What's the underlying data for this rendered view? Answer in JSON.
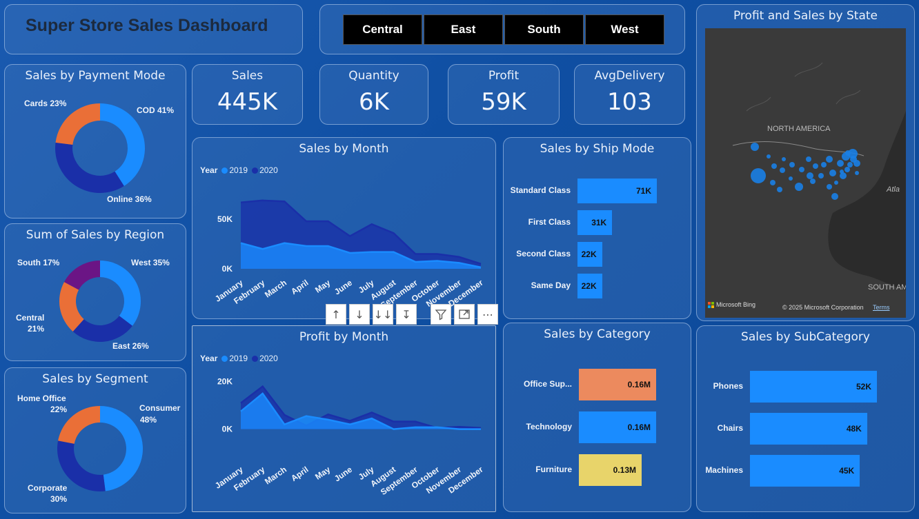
{
  "header": {
    "title": "Super Store Sales Dashboard"
  },
  "regions": [
    "Central",
    "East",
    "South",
    "West"
  ],
  "kpis": [
    {
      "label": "Sales",
      "value": "445K"
    },
    {
      "label": "Quantity",
      "value": "6K"
    },
    {
      "label": "Profit",
      "value": "59K"
    },
    {
      "label": "AvgDelivery",
      "value": "103"
    }
  ],
  "colors": {
    "primary": "#1a8cff",
    "dark": "#1a2fa8",
    "orange": "#ea6f37",
    "purple": "#6b1585",
    "office": "#ec8a5e",
    "furniture": "#e8d46a"
  },
  "payment_mode": {
    "title": "Sales by Payment Mode",
    "labels": [
      "COD 41%",
      "Online 36%",
      "Cards 23%"
    ]
  },
  "region_sales": {
    "title": "Sum of Sales by Region",
    "labels": [
      "West 35%",
      "East 26%",
      "Central",
      "21%",
      "South 17%"
    ]
  },
  "segment": {
    "title": "Sales by Segment",
    "labels": [
      "Consumer",
      "48%",
      "Corporate",
      "30%",
      "Home Office",
      "22%"
    ]
  },
  "sales_month": {
    "title": "Sales by Month",
    "legend_title": "Year",
    "legend": [
      "2019",
      "2020"
    ],
    "yticks": [
      "50K",
      "0K"
    ]
  },
  "profit_month": {
    "title": "Profit by Month",
    "legend_title": "Year",
    "legend": [
      "2019",
      "2020"
    ],
    "yticks": [
      "20K",
      "0K"
    ]
  },
  "months": [
    "January",
    "February",
    "March",
    "April",
    "May",
    "June",
    "July",
    "August",
    "September",
    "October",
    "November",
    "December"
  ],
  "ship_mode": {
    "title": "Sales by Ship Mode",
    "items": [
      {
        "name": "Standard Class",
        "value": "71K"
      },
      {
        "name": "First Class",
        "value": "31K"
      },
      {
        "name": "Second Class",
        "value": "22K"
      },
      {
        "name": "Same Day",
        "value": "22K"
      }
    ]
  },
  "category": {
    "title": "Sales by Category",
    "items": [
      {
        "name": "Office Sup...",
        "value": "0.16M"
      },
      {
        "name": "Technology",
        "value": "0.16M"
      },
      {
        "name": "Furniture",
        "value": "0.13M"
      }
    ]
  },
  "subcategory": {
    "title": "Sales by SubCategory",
    "items": [
      {
        "name": "Phones",
        "value": "52K"
      },
      {
        "name": "Chairs",
        "value": "48K"
      },
      {
        "name": "Machines",
        "value": "45K"
      }
    ]
  },
  "map": {
    "title": "Profit and Sales by State",
    "label_na": "NORTH AMERICA",
    "label_sa": "SOUTH AM",
    "label_atl": "Atla",
    "brand": "Microsoft Bing",
    "copyright": "© 2025 Microsoft Corporation",
    "terms": "Terms"
  },
  "chart_data": [
    {
      "type": "pie",
      "title": "Sales by Payment Mode",
      "categories": [
        "COD",
        "Online",
        "Cards"
      ],
      "values": [
        41,
        36,
        23
      ]
    },
    {
      "type": "pie",
      "title": "Sum of Sales by Region",
      "categories": [
        "West",
        "East",
        "Central",
        "South"
      ],
      "values": [
        35,
        26,
        21,
        17
      ]
    },
    {
      "type": "pie",
      "title": "Sales by Segment",
      "categories": [
        "Consumer",
        "Corporate",
        "Home Office"
      ],
      "values": [
        48,
        30,
        22
      ]
    },
    {
      "type": "area",
      "title": "Sales by Month",
      "ylim": [
        0,
        80000
      ],
      "categories": [
        "January",
        "February",
        "March",
        "April",
        "May",
        "June",
        "July",
        "August",
        "September",
        "October",
        "November",
        "December"
      ],
      "series": [
        {
          "name": "2019",
          "values": [
            26000,
            20000,
            26000,
            23000,
            23000,
            16000,
            17000,
            17000,
            7000,
            8000,
            6000,
            1500
          ]
        },
        {
          "name": "2020",
          "values": [
            67000,
            69000,
            68000,
            48000,
            48000,
            33000,
            45000,
            36000,
            15000,
            15000,
            12000,
            5000
          ]
        }
      ]
    },
    {
      "type": "area",
      "title": "Profit by Month",
      "ylim": [
        -3000,
        26000
      ],
      "categories": [
        "January",
        "February",
        "March",
        "April",
        "May",
        "June",
        "July",
        "August",
        "September",
        "October",
        "November",
        "December"
      ],
      "series": [
        {
          "name": "2019",
          "values": [
            7500,
            15000,
            2000,
            5500,
            4000,
            2000,
            4500,
            0,
            800,
            800,
            0,
            0
          ]
        },
        {
          "name": "2020",
          "values": [
            11000,
            18000,
            6000,
            1500,
            6200,
            3500,
            7000,
            3200,
            3200,
            500,
            1000,
            500
          ]
        }
      ]
    },
    {
      "type": "bar",
      "title": "Sales by Ship Mode",
      "categories": [
        "Standard Class",
        "First Class",
        "Second Class",
        "Same Day"
      ],
      "values": [
        71,
        31,
        22,
        22
      ]
    },
    {
      "type": "bar",
      "title": "Sales by Category",
      "categories": [
        "Office Sup...",
        "Technology",
        "Furniture"
      ],
      "values": [
        0.16,
        0.16,
        0.13
      ]
    },
    {
      "type": "bar",
      "title": "Sales by SubCategory",
      "categories": [
        "Phones",
        "Chairs",
        "Machines"
      ],
      "values": [
        52,
        48,
        45
      ]
    }
  ]
}
